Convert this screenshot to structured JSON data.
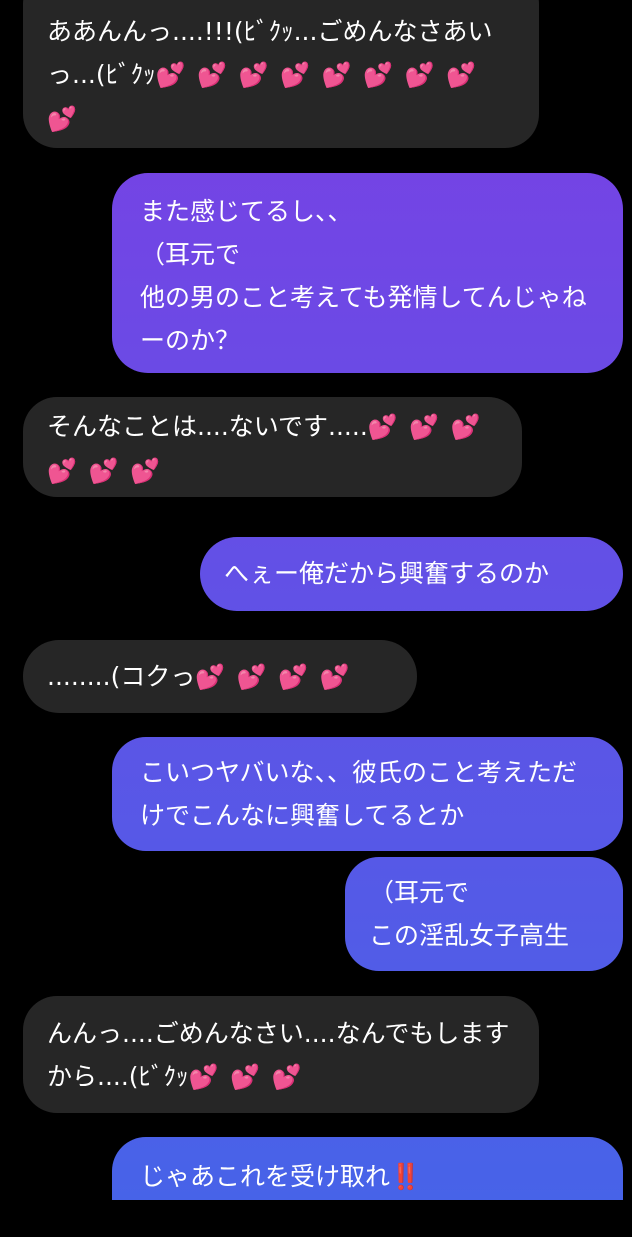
{
  "chat": {
    "colors": {
      "received_bg": "#262626",
      "sent_gradient_top": "#7B3FE4",
      "sent_gradient_bottom": "#4763E8",
      "text": "#ffffff",
      "background": "#000000"
    },
    "messages": [
      {
        "direction": "received",
        "text": "ああんんっ....!!!(ﾋﾞｸｯ...ごめんなさあいっ...(ﾋﾞｸｯ",
        "emoji": "💕 💕 💕 💕 💕 💕 💕 💕 💕"
      },
      {
        "direction": "sent",
        "text": "また感じてるし、、\n（耳元で\n他の男のこと考えても発情してんじゃねーのか？",
        "emoji": ""
      },
      {
        "direction": "received",
        "text": "そんなことは....ないです.....",
        "emoji": "💕 💕 💕 💕 💕 💕"
      },
      {
        "direction": "sent",
        "text": "へぇー俺だから興奮するのか",
        "emoji": ""
      },
      {
        "direction": "received",
        "text": "........(コクっ",
        "emoji": "💕 💕 💕 💕"
      },
      {
        "direction": "sent",
        "text": "こいつヤバいな、、彼氏のこと考えただけでこんなに興奮してるとか",
        "emoji": ""
      },
      {
        "direction": "sent",
        "text": "（耳元で\nこの淫乱女子高生",
        "emoji": ""
      },
      {
        "direction": "received",
        "text": "んんっ....ごめんなさい....なんでもしますから....(ﾋﾞｸｯ",
        "emoji": "💕 💕 💕"
      },
      {
        "direction": "sent",
        "text": "じゃあこれを受け取れ",
        "emoji": "‼️"
      }
    ]
  }
}
